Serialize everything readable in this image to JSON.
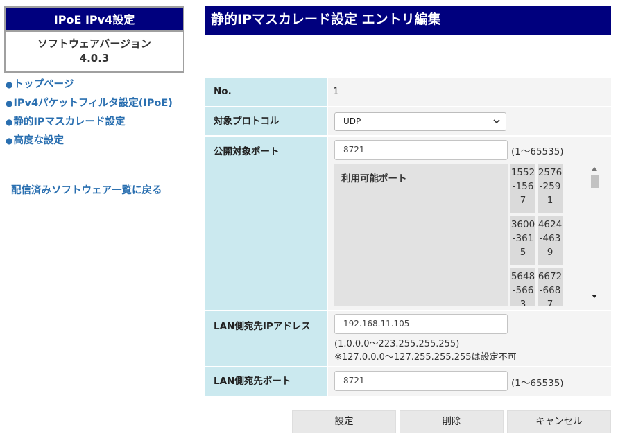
{
  "sidebar": {
    "app_title": "IPoE IPv4設定",
    "version_label": "ソフトウェアバージョン",
    "version_value": "4.0.3",
    "bullet": "●",
    "nav": [
      {
        "label": "トップページ"
      },
      {
        "label": "IPv4パケットフィルタ設定(IPoE)"
      },
      {
        "label": "静的IPマスカレード設定"
      },
      {
        "label": "高度な設定"
      }
    ],
    "back_link": "配信済みソフトウェア一覧に戻る"
  },
  "header": {
    "title": "静的IPマスカレード設定 エントリ編集"
  },
  "form": {
    "no": {
      "label": "No.",
      "value": "1"
    },
    "protocol": {
      "label": "対象プロトコル",
      "selected": "UDP"
    },
    "public_port": {
      "label": "公開対象ポート",
      "value": "8721",
      "range": "(1〜65535)",
      "available_title": "利用可能ポート",
      "available_ports": [
        [
          "1552",
          "-156",
          "7"
        ],
        [
          "2576",
          "-259",
          "1"
        ],
        [
          "3600",
          "-361",
          "5"
        ],
        [
          "4624",
          "-463",
          "9"
        ],
        [
          "5648",
          "-566",
          "3"
        ],
        [
          "6672",
          "-668",
          "7"
        ]
      ]
    },
    "lan_ip": {
      "label": "LAN側宛先IPアドレス",
      "value": "192.168.11.105",
      "note1": "(1.0.0.0〜223.255.255.255)",
      "note2": "※127.0.0.0〜127.255.255.255は設定不可"
    },
    "lan_port": {
      "label": "LAN側宛先ポート",
      "value": "8721",
      "range": "(1〜65535)"
    }
  },
  "buttons": {
    "set": "設定",
    "delete": "削除",
    "cancel": "キャンセル"
  },
  "colors": {
    "header_bg": "#00007e",
    "label_bg": "#cbe9ef",
    "link": "#2a6fb0"
  }
}
